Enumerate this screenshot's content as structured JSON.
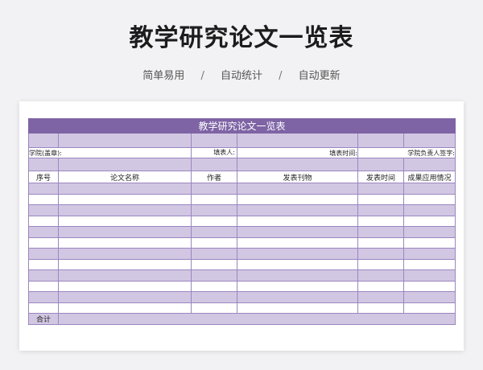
{
  "page": {
    "title": "教学研究论文一览表",
    "subtitle_items": [
      "简单易用",
      "自动统计",
      "自动更新"
    ],
    "separator": "/"
  },
  "sheet": {
    "title": "教学研究论文一览表",
    "info": {
      "school": "学院(盖章):",
      "filler": "填表人:",
      "date": "填表时间:",
      "responsible": "学院负责人签字:"
    },
    "columns": [
      "序号",
      "论文名称",
      "作者",
      "发表刊物",
      "发表时间",
      "成果应用情况"
    ],
    "total_label": "合计"
  },
  "colors": {
    "accent": "#7e64a5",
    "band": "#d2c7e3",
    "border": "#9a86bf"
  }
}
